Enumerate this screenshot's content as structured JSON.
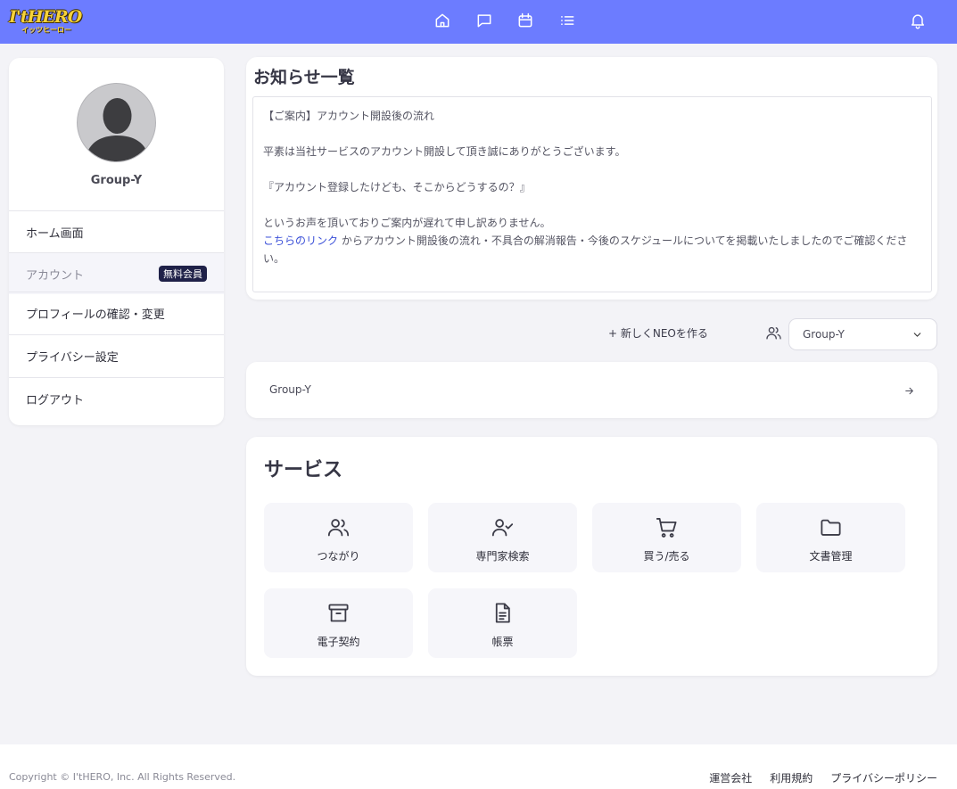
{
  "brand": {
    "logo_main": "I'tHERO",
    "logo_sub": "イッツヒーロー"
  },
  "header": {
    "nav": [
      {
        "name": "home-icon"
      },
      {
        "name": "message-icon"
      },
      {
        "name": "calendar-icon"
      },
      {
        "name": "list-icon"
      }
    ],
    "notification_icon": "bell-icon"
  },
  "sidebar": {
    "username": "Group-Y",
    "items": [
      {
        "label": "ホーム画面"
      },
      {
        "label": "アカウント",
        "badge": "無料会員"
      },
      {
        "label": "プロフィールの確認・変更"
      },
      {
        "label": "プライバシー設定"
      },
      {
        "label": "ログアウト"
      }
    ]
  },
  "notice": {
    "title": "お知らせ一覧",
    "lines": [
      "【ご案内】アカウント開設後の流れ",
      "",
      "平素は当社サービスのアカウント開設して頂き誠にありがとうございます。",
      "",
      "『アカウント登録したけども、そこからどうするの？』",
      "",
      "というお声を頂いておりご案内が遅れて申し訳ありません。"
    ],
    "link_text": "こちらのリンク",
    "link_follow": " からアカウント開設後の流れ・不具合の解消報告・今後のスケジュールについてを掲載いたしましたのでご確認ください。"
  },
  "neo": {
    "create_label": "+ 新しくNEOを作る",
    "group_select_value": "Group-Y"
  },
  "group_card": {
    "label": "Group-Y"
  },
  "services": {
    "title": "サービス",
    "items": [
      {
        "label": "つながり",
        "icon": "users-icon"
      },
      {
        "label": "専門家検索",
        "icon": "user-check-icon"
      },
      {
        "label": "買う/売る",
        "icon": "cart-icon"
      },
      {
        "label": "文書管理",
        "icon": "folder-icon"
      },
      {
        "label": "電子契約",
        "icon": "archive-icon"
      },
      {
        "label": "帳票",
        "icon": "document-icon"
      }
    ]
  },
  "footer": {
    "copyright": "Copyright © I'tHERO, Inc. All Rights Reserved.",
    "links": [
      "運営会社",
      "利用規約",
      "プライバシーポリシー"
    ]
  },
  "colors": {
    "header": "#6c7cff",
    "badge": "#1f2148",
    "link": "#3a4fd8"
  }
}
